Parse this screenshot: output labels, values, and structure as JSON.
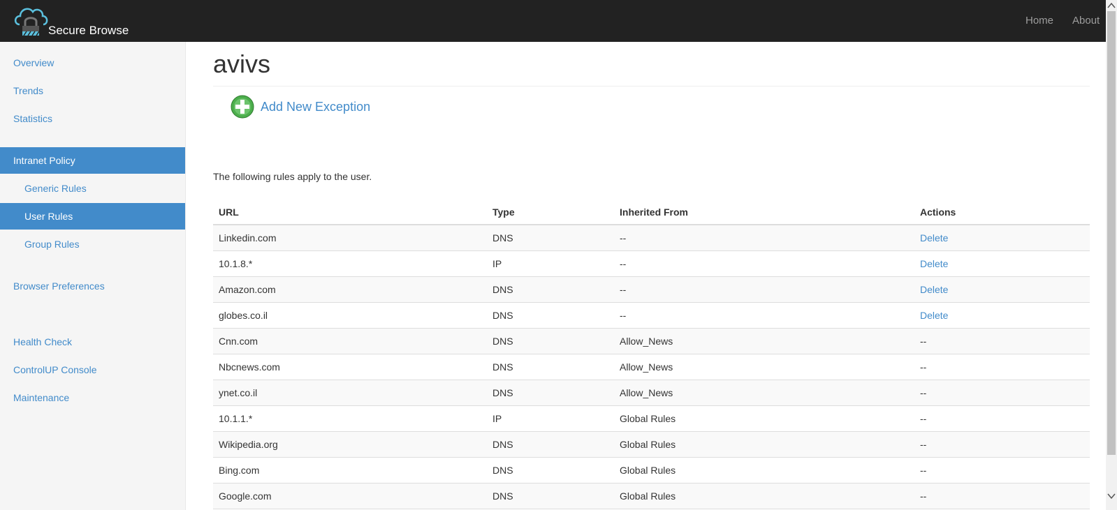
{
  "header": {
    "app_title": "Secure Browse",
    "logo_icon": "cloud-lock-icon",
    "nav": {
      "home": "Home",
      "about": "About"
    }
  },
  "sidebar": {
    "items": [
      {
        "label": "Overview"
      },
      {
        "label": "Trends"
      },
      {
        "label": "Statistics"
      },
      {
        "label": "Intranet Policy",
        "active": true
      },
      {
        "label": "Generic Rules"
      },
      {
        "label": "User Rules",
        "active": true
      },
      {
        "label": "Group Rules"
      },
      {
        "label": "Browser Preferences"
      },
      {
        "label": "Health Check"
      },
      {
        "label": "ControlUP Console"
      },
      {
        "label": "Maintenance"
      }
    ]
  },
  "main": {
    "title": "avivs",
    "add_button_label": "Add New Exception",
    "add_icon": "plus-circle-icon",
    "intro": "The following rules apply to the user."
  },
  "table": {
    "headers": [
      "URL",
      "Type",
      "Inherited From",
      "Actions"
    ],
    "rows": [
      [
        "Linkedin.com",
        "DNS",
        "--",
        "Delete"
      ],
      [
        "10.1.8.*",
        "IP",
        "--",
        "Delete"
      ],
      [
        "Amazon.com",
        "DNS",
        "--",
        "Delete"
      ],
      [
        "globes.co.il",
        "DNS",
        "--",
        "Delete"
      ],
      [
        "Cnn.com",
        "DNS",
        "Allow_News",
        "--"
      ],
      [
        "Nbcnews.com",
        "DNS",
        "Allow_News",
        "--"
      ],
      [
        "ynet.co.il",
        "DNS",
        "Allow_News",
        "--"
      ],
      [
        "10.1.1.*",
        "IP",
        "Global Rules",
        "--"
      ],
      [
        "Wikipedia.org",
        "DNS",
        "Global Rules",
        "--"
      ],
      [
        "Bing.com",
        "DNS",
        "Global Rules",
        "--"
      ],
      [
        "Google.com",
        "DNS",
        "Global Rules",
        "--"
      ]
    ]
  },
  "colors": {
    "header_bg": "#222222",
    "accent": "#428bca",
    "sidebar_bg": "#f5f5f5",
    "add_icon": "#4cae4c"
  }
}
